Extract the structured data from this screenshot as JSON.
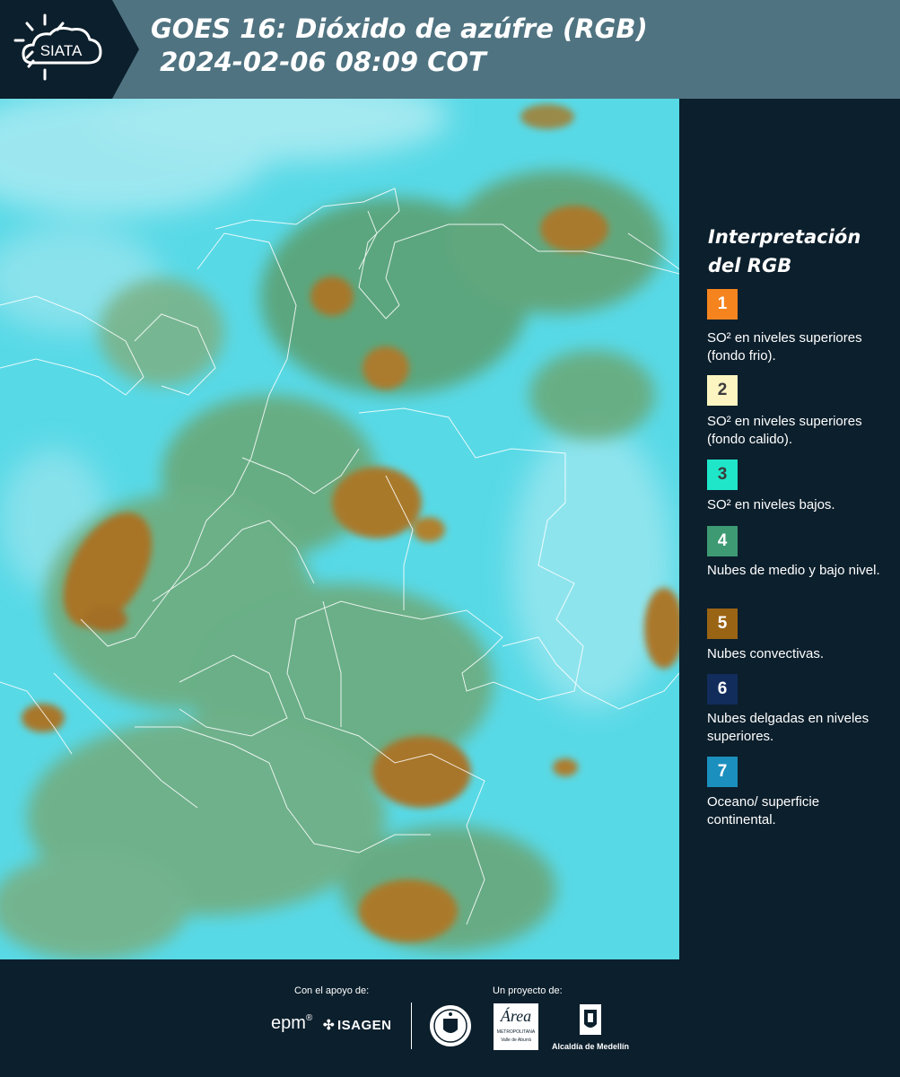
{
  "header": {
    "logo_text": "SIATA",
    "title_line1": "GOES 16: Dióxido de azúfre (RGB)",
    "title_line2": " 2024-02-06 08:09 COT"
  },
  "legend": {
    "title_line1": "Interpretación",
    "title_line2": "del RGB",
    "items": [
      {
        "number": "1",
        "color": "#f5841f",
        "text_color": "#ffffff",
        "label": "SO² en niveles superiores (fondo frio)."
      },
      {
        "number": "2",
        "color": "#fcf5c2",
        "text_color": "#3b3b3b",
        "label": "SO² en niveles superiores (fondo calido)."
      },
      {
        "number": "3",
        "color": "#1fe6c8",
        "text_color": "#3b3b3b",
        "label": "SO² en niveles bajos."
      },
      {
        "number": "4",
        "color": "#3d9a73",
        "text_color": "#ffffff",
        "label": "Nubes de medio y bajo nivel."
      },
      {
        "number": "5",
        "color": "#9a6415",
        "text_color": "#ffffff",
        "label": "Nubes convectivas."
      },
      {
        "number": "6",
        "color": "#122d5c",
        "text_color": "#ffffff",
        "label": "Nubes delgadas en niveles superiores."
      },
      {
        "number": "7",
        "color": "#1b8fbd",
        "text_color": "#ffffff",
        "label": "Oceano/ superficie continental."
      }
    ]
  },
  "footer": {
    "support_label": "Con el apoyo de:",
    "project_label": "Un proyecto de:",
    "epm_text": "epm",
    "isagen_text": "ISAGEN",
    "area_text": "Área",
    "area_sub1": "METROPOLITANA",
    "area_sub2": "Valle de Aburrá",
    "alcaldia_text": "Alcaldía de Medellín"
  },
  "colors": {
    "header_bg": "#4f7381",
    "panel_bg": "#0c1f2c",
    "sky_cyan": "#4fd6e3",
    "cloud_orange": "#b07a2a",
    "cloud_green": "#5a9e6a"
  }
}
